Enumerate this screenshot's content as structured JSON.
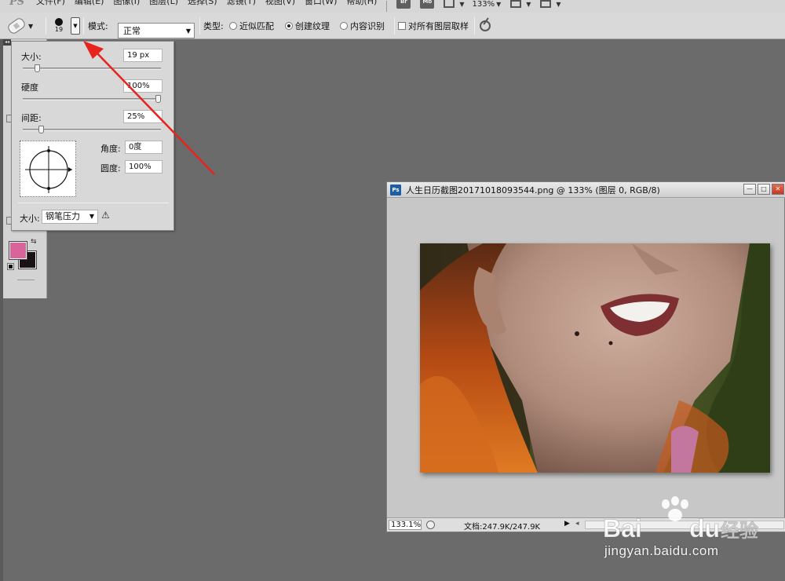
{
  "menubar": {
    "logo": "PS",
    "items": [
      "文件(F)",
      "编辑(E)",
      "图像(I)",
      "图层(L)",
      "选择(S)",
      "滤镜(T)",
      "视图(V)",
      "窗口(W)",
      "帮助(H)"
    ],
    "bridge_badge": "Br",
    "minibridge_badge": "Mb",
    "zoom": "133%"
  },
  "options": {
    "brush_size_number": "19",
    "mode_label": "模式:",
    "mode_value": "正常",
    "type_label": "类型:",
    "type_options": [
      {
        "label": "近似匹配",
        "selected": false
      },
      {
        "label": "创建纹理",
        "selected": true
      },
      {
        "label": "内容识别",
        "selected": false
      }
    ],
    "sample_all_layers": {
      "label": "对所有图层取样",
      "checked": false
    }
  },
  "brush_popup": {
    "size_label": "大小:",
    "size_value": "19 px",
    "size_slider": 0.09,
    "hardness_label": "硬度",
    "hardness_value": "100%",
    "hardness_slider": 1.0,
    "spacing_label": "间距:",
    "spacing_value": "25%",
    "spacing_slider": 0.12,
    "angle_label": "角度:",
    "angle_value": "0度",
    "roundness_label": "圆度:",
    "roundness_value": "100%",
    "pen_size_label": "大小:",
    "pen_size_value": "钢笔压力"
  },
  "toolbox": {
    "foreground_color": "#d9649a",
    "background_color": "#1b1214"
  },
  "document": {
    "title": "人生日历截图20171018093544.png @ 133% (图层 0, RGB/8)",
    "zoom": "133.1%",
    "doc_info": "文档:247.9K/247.9K"
  },
  "watermark": {
    "brand": "Baidu",
    "brand_cn": "经验",
    "url": "jingyan.baidu.com"
  },
  "colors": {
    "arrow": "#e8221c",
    "menubar": "#d6d6d6",
    "workspace": "#6b6b6b"
  }
}
